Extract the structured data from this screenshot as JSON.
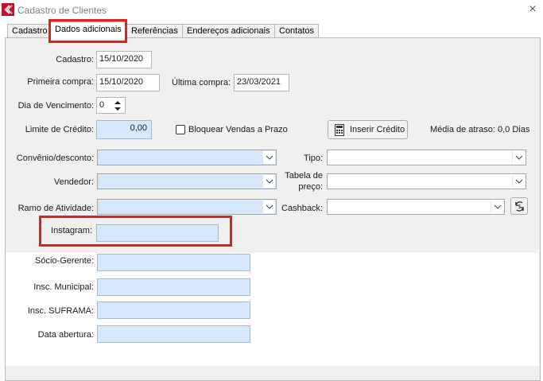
{
  "window": {
    "title": "Cadastro de Clientes",
    "close_glyph": "×"
  },
  "tabs": [
    {
      "label": "Cadastro"
    },
    {
      "label": "Dados adicionais"
    },
    {
      "label": "Referências"
    },
    {
      "label": "Endereços adicionais"
    },
    {
      "label": "Contatos"
    }
  ],
  "form": {
    "cadastro_label": "Cadastro:",
    "cadastro_value": "15/10/2020",
    "primeira_compra_label": "Primeira compra:",
    "primeira_compra_value": "15/10/2020",
    "ultima_compra_label": "Última compra:",
    "ultima_compra_value": "23/03/2021",
    "dia_vencimento_label": "Dia de Vencimento:",
    "dia_vencimento_value": "0",
    "limite_credito_label": "Limite de Crédito:",
    "limite_credito_value": "0,00",
    "bloquear_label": "Bloquear Vendas a Prazo",
    "inserir_credito_label": "Inserir Crédito",
    "media_atraso_text": "Média de atraso: 0,0 Dias",
    "convenio_label": "Convênio/desconto:",
    "tipo_label": "Tipo:",
    "vendedor_label": "Vendedor:",
    "tabela_preco_label_1": "Tabela de",
    "tabela_preco_label_2": "preço:",
    "ramo_label": "Ramo de Atividade:",
    "cashback_label": "Cashback:",
    "instagram_label": "Instagram:",
    "instagram_value": "",
    "socio_label": "Sócio-Gerente:",
    "insc_municipal_label": "Insc. Municipal:",
    "insc_suframa_label": "Insc. SUFRAMA:",
    "data_abertura_label": "Data abertura:"
  },
  "colors": {
    "highlight": "#e02020",
    "field_blue": "#d6e8fb",
    "app_icon": "#c8102e"
  }
}
